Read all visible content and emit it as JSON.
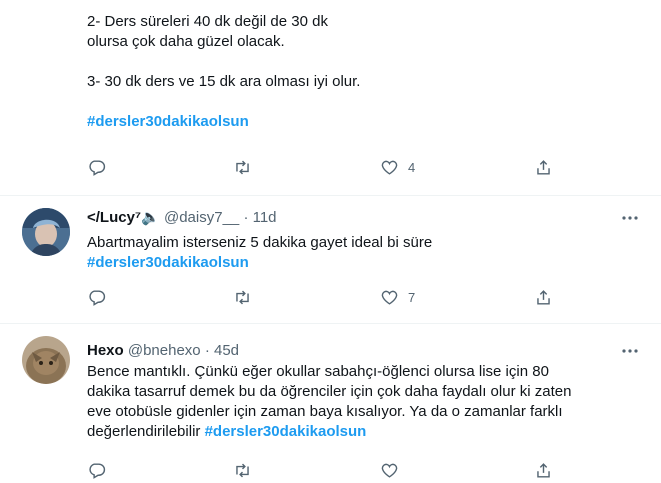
{
  "tweet1": {
    "lines": [
      "2- Ders süreleri 40 dk değil de 30 dk",
      "olursa çok daha güzel olacak.",
      "",
      "3- 30 dk ders ve 15 dk ara olması iyi olur.",
      ""
    ],
    "hashtag": "#dersler30dakikaolsun",
    "likes": "4"
  },
  "tweet2": {
    "name": "</Lucy⁷🔈",
    "handle": "@daisy7__",
    "separator": "·",
    "time": "11d",
    "text": "Abartmayalim isterseniz 5 dakika gayet ideal bi süre",
    "hashtag": "#dersler30dakikaolsun",
    "likes": "7"
  },
  "tweet3": {
    "name": "Hexo",
    "handle": "@bnehexo",
    "separator": "·",
    "time": "45d",
    "lines": [
      "Bence mantıklı. Çünkü eğer okullar sabahçı-öğlenci olursa lise için 80",
      "dakika tasarruf demek bu da öğrenciler için çok daha faydalı olur ki zaten",
      "eve otobüsle gidenler için zaman baya kısalıyor. Ya da o zamanlar farklı"
    ],
    "last_line_prefix": "değerlendirilebilir ",
    "hashtag": "#dersler30dakikaolsun"
  },
  "icons": {
    "reply": "reply-icon",
    "retweet": "retweet-icon",
    "like": "heart-icon",
    "share": "share-icon",
    "more": "more-icon"
  },
  "colors": {
    "accent": "#1d9bf0",
    "secondary_text": "#536471",
    "divider": "#eff3f4"
  }
}
